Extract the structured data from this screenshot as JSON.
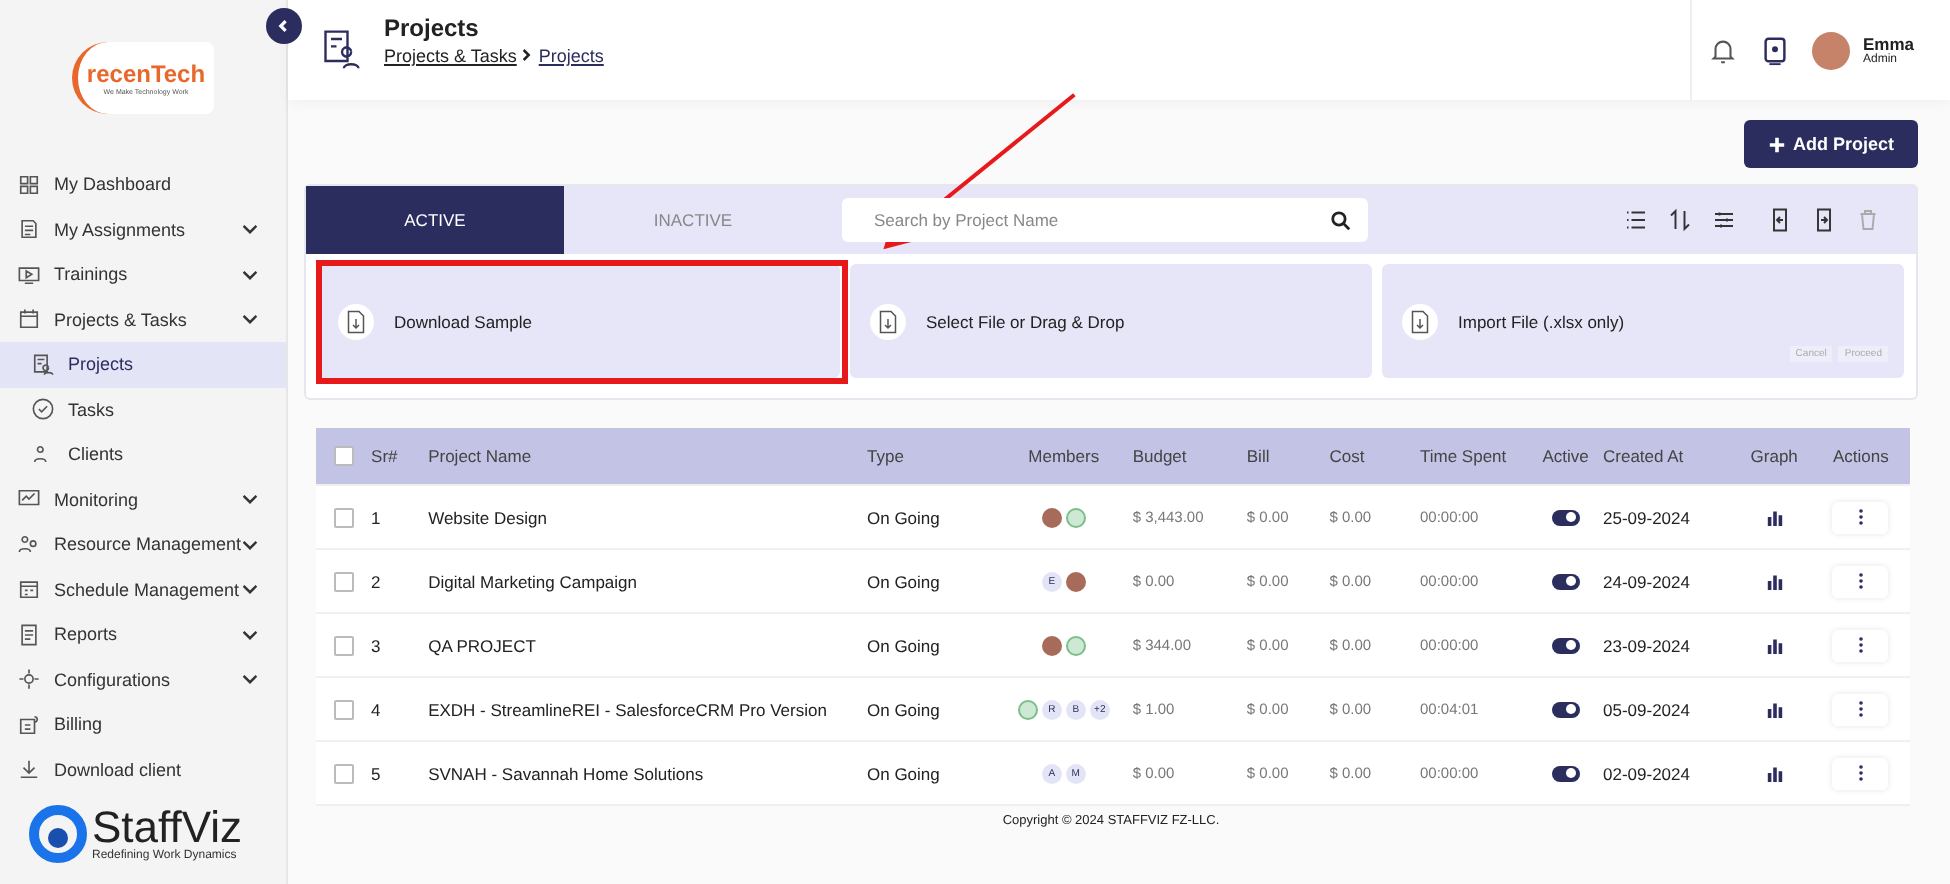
{
  "sidebar": {
    "logo": {
      "name": "recenTech",
      "tagline": "We Make Technology Work"
    },
    "items": [
      {
        "label": "My Dashboard",
        "expandable": false,
        "selected": false
      },
      {
        "label": "My Assignments",
        "expandable": true,
        "selected": false
      },
      {
        "label": "Trainings",
        "expandable": true,
        "selected": false
      },
      {
        "label": "Projects & Tasks",
        "expandable": true,
        "selected": false,
        "children": [
          {
            "label": "Projects",
            "selected": true
          },
          {
            "label": "Tasks",
            "selected": false
          },
          {
            "label": "Clients",
            "selected": false
          }
        ]
      },
      {
        "label": "Monitoring",
        "expandable": true,
        "selected": false
      },
      {
        "label": "Resource Management",
        "expandable": true,
        "selected": false
      },
      {
        "label": "Schedule Management",
        "expandable": true,
        "selected": false
      },
      {
        "label": "Reports",
        "expandable": true,
        "selected": false
      },
      {
        "label": "Configurations",
        "expandable": true,
        "selected": false
      },
      {
        "label": "Billing",
        "expandable": false,
        "selected": false
      },
      {
        "label": "Download client",
        "expandable": false,
        "selected": false
      }
    ],
    "brand": {
      "name": "StaffViz",
      "tagline": "Redefining Work Dynamics"
    }
  },
  "header": {
    "title": "Projects",
    "breadcrumb": [
      "Projects & Tasks",
      "Projects"
    ],
    "user": {
      "name": "Emma",
      "role": "Admin"
    }
  },
  "add_button": "Add Project",
  "tabs": [
    {
      "label": "ACTIVE",
      "selected": true
    },
    {
      "label": "INACTIVE",
      "selected": false
    }
  ],
  "search": {
    "placeholder": "Search by Project Name"
  },
  "import": {
    "cards": [
      "Download Sample",
      "Select File or Drag & Drop",
      "Import File (.xlsx only)"
    ],
    "buttons": [
      "Cancel",
      "Proceed"
    ]
  },
  "table": {
    "select_all_checked": false,
    "columns": [
      "Sr#",
      "Project Name",
      "Type",
      "Members",
      "Budget",
      "Bill",
      "Cost",
      "Time Spent",
      "Active",
      "Created At",
      "Graph",
      "Actions"
    ],
    "rows": [
      {
        "sr": "1",
        "name": "Website Design",
        "type": "On Going",
        "members": [
          {
            "kind": "photo"
          },
          {
            "kind": "globe"
          }
        ],
        "budget": "$ 3,443.00",
        "bill": "$ 0.00",
        "cost": "$ 0.00",
        "time": "00:00:00",
        "active": true,
        "created": "25-09-2024",
        "checked": false
      },
      {
        "sr": "2",
        "name": "Digital Marketing Campaign",
        "type": "On Going",
        "members": [
          {
            "kind": "initial",
            "text": "E"
          },
          {
            "kind": "photo"
          }
        ],
        "budget": "$ 0.00",
        "bill": "$ 0.00",
        "cost": "$ 0.00",
        "time": "00:00:00",
        "active": true,
        "created": "24-09-2024",
        "checked": false
      },
      {
        "sr": "3",
        "name": "QA PROJECT",
        "type": "On Going",
        "members": [
          {
            "kind": "photo"
          },
          {
            "kind": "globe"
          }
        ],
        "budget": "$ 344.00",
        "bill": "$ 0.00",
        "cost": "$ 0.00",
        "time": "00:00:00",
        "active": true,
        "created": "23-09-2024",
        "checked": false
      },
      {
        "sr": "4",
        "name": "EXDH - StreamlineREI - SalesforceCRM Pro Version",
        "type": "On Going",
        "members": [
          {
            "kind": "globe"
          },
          {
            "kind": "initial",
            "text": "R"
          },
          {
            "kind": "initial",
            "text": "B"
          },
          {
            "kind": "initial",
            "text": "+2"
          }
        ],
        "budget": "$ 1.00",
        "bill": "$ 0.00",
        "cost": "$ 0.00",
        "time": "00:04:01",
        "active": true,
        "created": "05-09-2024",
        "checked": false
      },
      {
        "sr": "5",
        "name": "SVNAH - Savannah Home Solutions",
        "type": "On Going",
        "members": [
          {
            "kind": "initial",
            "text": "A"
          },
          {
            "kind": "initial",
            "text": "M"
          }
        ],
        "budget": "$ 0.00",
        "bill": "$ 0.00",
        "cost": "$ 0.00",
        "time": "00:00:00",
        "active": true,
        "created": "02-09-2024",
        "checked": false
      }
    ]
  },
  "footer": "Copyright © 2024 STAFFVIZ FZ-LLC."
}
